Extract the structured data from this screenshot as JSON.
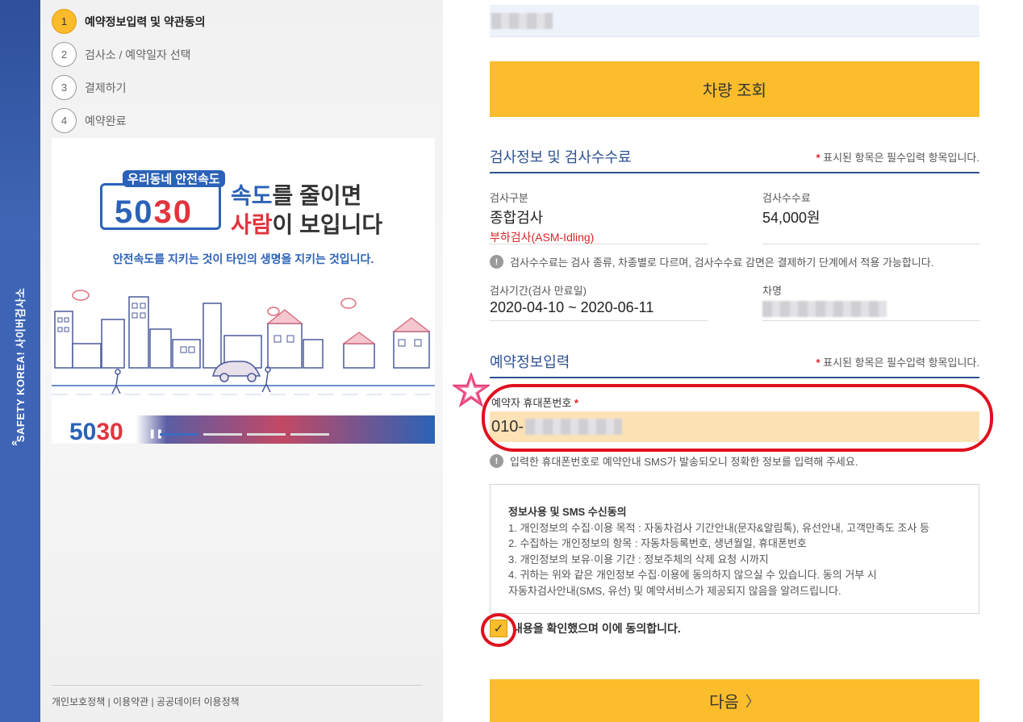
{
  "sidebar_vertical": {
    "text": "SAFETY KOREA! 사이버검사소",
    "arrow": "«"
  },
  "steps": [
    {
      "num": "1",
      "label": "예약정보입력 및 약관동의",
      "active": true
    },
    {
      "num": "2",
      "label": "검사소 / 예약일자 선택",
      "active": false
    },
    {
      "num": "3",
      "label": "결제하기",
      "active": false
    },
    {
      "num": "4",
      "label": "예약완료",
      "active": false
    }
  ],
  "banner": {
    "logo_top": "우리동네 안전속도",
    "logo_num_a": "50",
    "logo_num_b": "30",
    "slogan1_a": "속도",
    "slogan1_b": "를 줄이면",
    "slogan2_a": "사람",
    "slogan2_b": "이 보입니다",
    "slogan3": "안전속도를 지키는 것이 타인의 생명을 지키는 것입니다.",
    "bottom_num_a": "50",
    "bottom_num_b": "30",
    "pause_icon": "pause-icon"
  },
  "footer": {
    "links": "개인보호정책 | 이용약관 | 공공데이터 이용정책"
  },
  "form": {
    "lookup_button": "차량 조회",
    "section1": {
      "title": "검사정보 및 검사수수료",
      "required_note": "표시된 항목은 필수입력 항목입니다."
    },
    "inspection_type": {
      "label": "검사구분",
      "value": "종합검사",
      "sub": "부하검사(ASM-Idling)"
    },
    "fee": {
      "label": "검사수수료",
      "value": "54,000원"
    },
    "fee_info": "검사수수료는 검사 종류, 차종별로 다르며, 검사수수료 감면은 결제하기 단계에서 적용 가능합니다.",
    "period": {
      "label": "검사기간(검사 만료일)",
      "value": "2020-04-10 ~ 2020-06-11"
    },
    "car_name": {
      "label": "차명"
    },
    "section2": {
      "title": "예약정보입력",
      "required_note": "표시된 항목은 필수입력 항목입니다."
    },
    "phone": {
      "label": "예약자 휴대폰번호",
      "value_prefix": "010-"
    },
    "phone_info": "입력한 휴대폰번호로 예약안내 SMS가 발송되오니 정확한 정보를 입력해 주세요.",
    "consent": {
      "title": "정보사용 및 SMS 수신동의",
      "lines": [
        "1. 개인정보의 수집·이용 목적 : 자동차검사 기간안내(문자&알림톡), 유선안내, 고객만족도 조사 등",
        "2. 수집하는 개인정보의 항목 : 자동차등록번호, 생년월일, 휴대폰번호",
        "3. 개인정보의 보유·이용 기간 : 정보주체의 삭제 요청 시까지",
        "4. 귀하는 위와 같은 개인정보 수집·이용에 동의하지 않으실 수 있습니다. 동의 거부 시",
        "자동차검사안내(SMS, 유선) 및 예약서비스가 제공되지 않음을 알려드립니다."
      ]
    },
    "agree_label": "내용을 확인했으며 이에 동의합니다.",
    "next_button": "다음",
    "next_chevron": "〉"
  },
  "colors": {
    "accent_yellow": "#fbbd2b",
    "navy": "#2d5391",
    "required_red": "#d9242b",
    "highlight_red": "#e0101e",
    "phone_bg": "#fde2b5",
    "sidebar_blue": "#3e64b5"
  }
}
